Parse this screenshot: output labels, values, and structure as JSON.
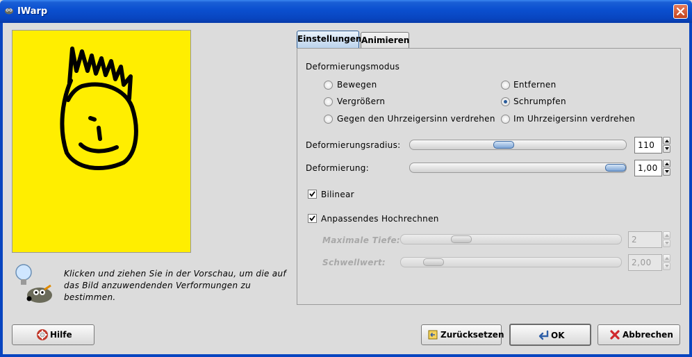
{
  "window": {
    "title": "IWarp",
    "icon": "gimp-wilber-icon"
  },
  "preview": {
    "background": "#ffee00",
    "stroke": "#000000"
  },
  "hint": {
    "text": "Klicken und ziehen Sie in der Vorschau, um die auf das Bild anzuwendenden Verformungen zu bestimmen."
  },
  "tabs": [
    {
      "label": "Einstellungen",
      "active": true
    },
    {
      "label": "Animieren",
      "active": false
    }
  ],
  "settings": {
    "mode_label": "Deformierungsmodus",
    "modes": [
      {
        "label": "Bewegen",
        "checked": false
      },
      {
        "label": "Entfernen",
        "checked": false
      },
      {
        "label": "Vergrößern",
        "checked": false
      },
      {
        "label": "Schrumpfen",
        "checked": true
      },
      {
        "label": "Gegen den Uhrzeigersinn verdrehen",
        "checked": false
      },
      {
        "label": "Im Uhrzeigersinn verdrehen",
        "checked": false
      }
    ],
    "radius": {
      "label": "Deformierungsradius:",
      "value": "110",
      "level": 0.44
    },
    "amount": {
      "label": "Deformierung:",
      "value": "1,00",
      "level": 0.98
    },
    "bilinear": {
      "label": "Bilinear",
      "checked": true
    },
    "supersample": {
      "label": "Anpassendes Hochrechnen",
      "checked": true
    },
    "max_depth": {
      "label": "Maximale Tiefe:",
      "value": "2",
      "level": 0.27
    },
    "threshold": {
      "label": "Schwellwert:",
      "value": "2,00",
      "level": 0.1
    }
  },
  "buttons": {
    "help": "Hilfe",
    "reset": "Zurücksetzen",
    "ok": "OK",
    "cancel": "Abbrechen"
  }
}
